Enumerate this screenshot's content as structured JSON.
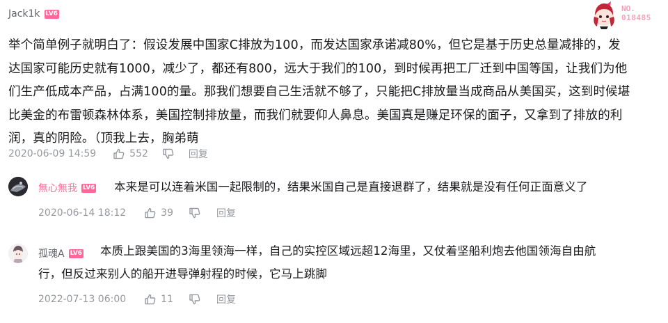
{
  "top_right": {
    "badge_number_prefix": "NO.",
    "badge_number": "018485"
  },
  "main_comment": {
    "username": "Jack1k",
    "level": "LV6",
    "text_lines": [
      "举个简单例子就明白了：假设发展中国家C排放为100，而发达国家承诺减80%，但它是基于历史总量减排的，发",
      "达国家可能历史就有1000，减少了，都还有800，远大于我们的100，到时候再把工厂迁到中国等国，让我们为他",
      "们生产低成本产品，占满100的量。那我们想要自己生活就不够了，只能把C排放量当成商品从美国买，这到时候堪",
      "比美金的布雷顿森林体系，美国控制排放量，而我们就要仰人鼻息。美国真是赚足环保的面子，又拿到了排放的利",
      "润，真的阴险。（顶我上去，胸弟萌"
    ],
    "timestamp": "2020-06-09 14:59",
    "likes": "552",
    "reply_label": "回复"
  },
  "replies": [
    {
      "username": "無心無我",
      "level": "LV6",
      "text_lines": [
        "本来是可以连着米国一起限制的，结果米国自己是直接退群了，结果就是没有任何正面意义了"
      ],
      "timestamp": "2020-06-14 18:12",
      "likes": "39",
      "reply_label": "回复"
    },
    {
      "username": "孤魂A",
      "level": "LV6",
      "text_lines": [
        "本质上跟美国的3海里领海一样，自己的实控区域远超12海里，又仗着坚船利炮去他国领海自由航",
        "行，但反过来别人的船开进导弹射程的时候，它马上跳脚"
      ],
      "timestamp": "2022-07-13 06:00",
      "likes": "11",
      "reply_label": "回复"
    }
  ],
  "colors": {
    "username_main": "#61666d",
    "username_reply1": "#fb7299",
    "level_badge": "#ff6699",
    "meta": "#9499a0"
  },
  "icons": {
    "like": "thumbs-up-icon",
    "dislike": "thumbs-down-icon",
    "avatar_decoration": "anime-girl-avatar"
  }
}
